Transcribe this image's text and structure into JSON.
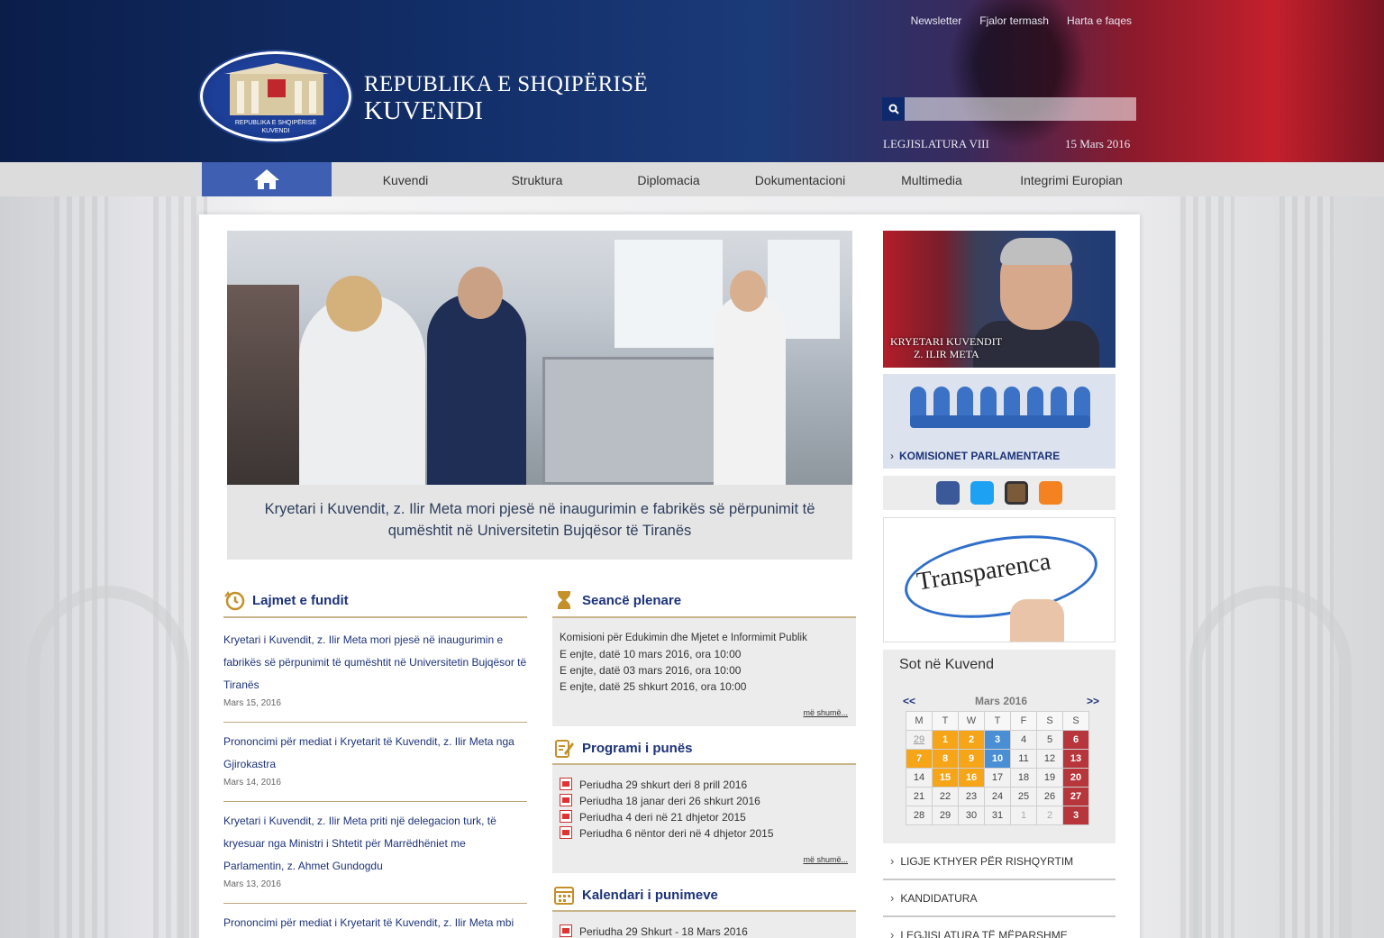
{
  "header": {
    "top_links": [
      "Newsletter",
      "Fjalor termash",
      "Harta e faqes"
    ],
    "brand_line1": "REPUBLIKA E SHQIPËRISË",
    "brand_line2": "KUVENDI",
    "logo_small_1": "REPUBLIKA E SHQIPËRISË",
    "logo_small_2": "KUVENDI",
    "search_placeholder": "",
    "legislature": "LEGJISLATURA VIII",
    "date": "15 Mars 2016"
  },
  "nav": {
    "items": [
      "Kuvendi",
      "Struktura",
      "Diplomacia",
      "Dokumentacioni",
      "Multimedia",
      "Integrimi Europian"
    ]
  },
  "hero": {
    "caption": "Kryetari i Kuvendit, z. Ilir Meta mori pjesë në inaugurimin e fabrikës së përpunimit të qumështit në Universitetin Bujqësor të Tiranës"
  },
  "news": {
    "title": "Lajmet e fundit",
    "items": [
      {
        "text": "Kryetari i Kuvendit, z. Ilir Meta mori pjesë në inaugurimin e fabrikës së përpunimit të qumështit në Universitetin Bujqësor të Tiranës",
        "date": "Mars 15, 2016"
      },
      {
        "text": "Prononcimi për mediat i Kryetarit të Kuvendit, z. Ilir Meta nga Gjirokastra",
        "date": "Mars 14, 2016"
      },
      {
        "text": "Kryetari i Kuvendit, z. Ilir Meta priti një delegacion turk, të kryesuar nga Ministri i Shtetit për Marrëdhëniet me Parlamentin, z. Ahmet Gundogdu",
        "date": "Mars 13, 2016"
      },
      {
        "text": "Prononcimi për mediat i Kryetarit të Kuvendit, z. Ilir Meta mbi",
        "date": ""
      }
    ]
  },
  "plenary": {
    "title": "Seancë plenare",
    "rows": [
      "Komisioni për Edukimin dhe Mjetet e Informimit Publik",
      "E enjte, datë 10 mars 2016, ora 10:00",
      "E enjte, datë 03 mars 2016, ora 10:00",
      "E enjte, datë 25 shkurt 2016, ora 10:00"
    ],
    "more": "më shumë..."
  },
  "program": {
    "title": "Programi i punës",
    "rows": [
      "Periudha 29 shkurt deri 8 prill 2016",
      "Periudha 18 janar deri 26 shkurt 2016",
      "Periudha 4 deri në 21 dhjetor 2015",
      "Periudha 6 nëntor deri në 4 dhjetor 2015"
    ],
    "more": "më shumë..."
  },
  "calendar_works": {
    "title": "Kalendari i punimeve",
    "rows": [
      "Periudha 29 Shkurt - 18 Mars 2016"
    ]
  },
  "sidebar": {
    "president_label_1": "KRYETARI KUVENDIT",
    "president_label_2": "Z. ILIR META",
    "committees_label": "KOMISIONET PARLAMENTARE",
    "transparency_word": "Transparenca",
    "social_icons": [
      "facebook-icon",
      "twitter-icon",
      "tv-icon",
      "rss-icon"
    ],
    "today_title": "Sot në Kuvend",
    "links": [
      "LIGJE KTHYER PËR RISHQYRTIM",
      "KANDIDATURA",
      "LEGJISLATURA TË MËPARSHME"
    ]
  },
  "calendar": {
    "prev": "<<",
    "next": ">>",
    "month": "Mars 2016",
    "weekdays": [
      "M",
      "T",
      "W",
      "T",
      "F",
      "S",
      "S"
    ],
    "weeks": [
      [
        "29",
        "1",
        "2",
        "3",
        "4",
        "5",
        "6"
      ],
      [
        "7",
        "8",
        "9",
        "10",
        "11",
        "12",
        "13"
      ],
      [
        "14",
        "15",
        "16",
        "17",
        "18",
        "19",
        "20"
      ],
      [
        "21",
        "22",
        "23",
        "24",
        "25",
        "26",
        "27"
      ],
      [
        "28",
        "29",
        "30",
        "31",
        "1",
        "2",
        "3"
      ]
    ]
  },
  "colors": {
    "nav_home": "#3f5fb2",
    "link": "#1d3378",
    "accent_line": "#c9b58a",
    "cal_orange": "#f6a418",
    "cal_blue": "#4a8fd3",
    "cal_red": "#b6363c"
  }
}
